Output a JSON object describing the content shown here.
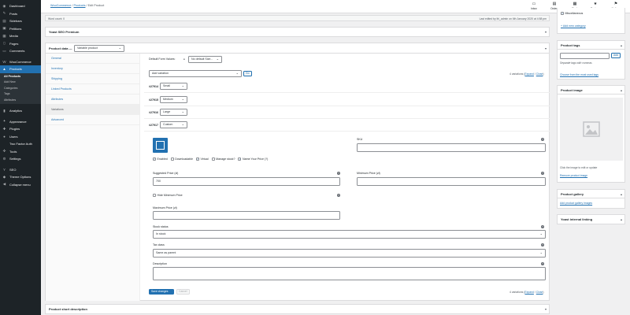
{
  "sidebar": {
    "items": [
      {
        "label": "Dashboard",
        "icon": "◉"
      },
      {
        "label": "Posts",
        "icon": "✎"
      },
      {
        "label": "Sidebars",
        "icon": "▤"
      },
      {
        "label": "Petitions",
        "icon": "▣"
      },
      {
        "label": "Media",
        "icon": "▦"
      },
      {
        "label": "Pages",
        "icon": "▯"
      },
      {
        "label": "Comments",
        "icon": "▭"
      }
    ],
    "items2": [
      {
        "label": "WooCommerce",
        "icon": "W"
      },
      {
        "label": "Products",
        "icon": "▲"
      }
    ],
    "products_sub": [
      "All Products",
      "Add New",
      "Categories",
      "Tags",
      "Attributes"
    ],
    "items3": [
      {
        "label": "Analytics",
        "icon": "▮"
      }
    ],
    "items4": [
      {
        "label": "Appearance",
        "icon": "✦"
      },
      {
        "label": "Plugins",
        "icon": "✚"
      },
      {
        "label": "Users",
        "icon": "●"
      },
      {
        "label": "Two Factor Auth",
        "icon": ""
      },
      {
        "label": "Tools",
        "icon": "✜"
      },
      {
        "label": "Settings",
        "icon": "⚙"
      }
    ],
    "items5": [
      {
        "label": "SEO",
        "icon": "Y"
      },
      {
        "label": "Theme Options",
        "icon": "◆"
      },
      {
        "label": "Collapse menu",
        "icon": "◀"
      }
    ]
  },
  "topbar": {
    "crumb1": "WooCommerce",
    "crumb2": "Products",
    "crumb3": "Edit Product",
    "icons": [
      {
        "label": "Inbox",
        "glyph": "▭"
      },
      {
        "label": "Orders",
        "glyph": "▤"
      },
      {
        "label": "Stock",
        "glyph": "▦"
      },
      {
        "label": "Reviews",
        "glyph": "★"
      },
      {
        "label": "Notices",
        "glyph": "⚑"
      }
    ]
  },
  "info": {
    "wordcount": "Word count: 0",
    "lastedited": "Last edited by lhl_admin on 6th January 2020 at 4:58 pm"
  },
  "yoast": {
    "title": "Yoast SEO Premium"
  },
  "productdata": {
    "title": "Product data —",
    "type": "Variable product",
    "tabs": [
      "General",
      "Inventory",
      "Shipping",
      "Linked Products",
      "Attributes",
      "Variations",
      "Advanced"
    ],
    "default_label": "Default Form Values:",
    "default_value": "No default Size...",
    "add_variation": "Add variation",
    "go": "Go",
    "var_count": "4 variations",
    "expand": "Expand",
    "close": "Close",
    "variations": [
      {
        "id": "#27914",
        "size": "Small"
      },
      {
        "id": "#27915",
        "size": "Medium"
      },
      {
        "id": "#27916",
        "size": "Large"
      },
      {
        "id": "#27917",
        "size": "Custom"
      }
    ],
    "sku_label": "SKU",
    "checks": [
      "Enabled",
      "Downloadable",
      "Virtual",
      "Manage stock?",
      "Name Your Price (?)"
    ],
    "suggested_label": "Suggested Price (zł)",
    "suggested_value": "700",
    "minimum_label": "Minimum Price (zł)",
    "hide_min": "Hide Minimum Price",
    "max_label": "Maximum Price (zł)",
    "stock_label": "Stock status",
    "stock_value": "In stock",
    "tax_label": "Tax class",
    "tax_value": "Same as parent",
    "desc_label": "Description",
    "save": "Save changes",
    "cancel": "Cancel"
  },
  "short_desc": {
    "title": "Product short description"
  },
  "right": {
    "misc": "Miscellaneous",
    "add_cat": "+ Add new category",
    "tags_title": "Product tags",
    "add": "Add",
    "separate": "Separate tags with commas",
    "choose": "Choose from the most used tags",
    "image_title": "Product image",
    "click_hint": "Click the image to edit or update",
    "remove": "Remove product image",
    "gallery_title": "Product gallery",
    "add_gallery": "Add product gallery images",
    "linking_title": "Yoast internal linking"
  }
}
